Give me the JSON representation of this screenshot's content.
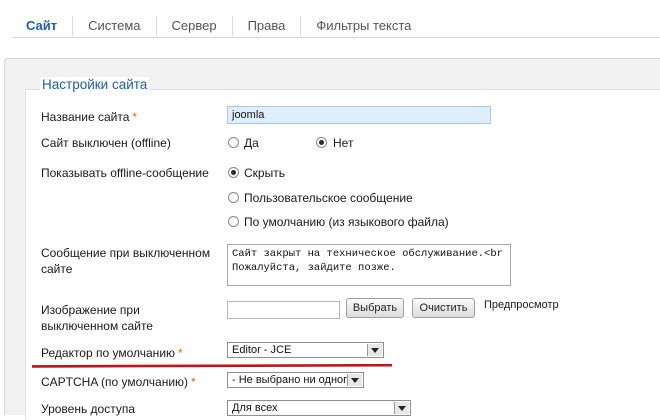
{
  "tabs": [
    {
      "label": "Сайт"
    },
    {
      "label": "Система"
    },
    {
      "label": "Сервер"
    },
    {
      "label": "Права"
    },
    {
      "label": "Фильтры текста"
    }
  ],
  "section": {
    "legend": "Настройки сайта"
  },
  "fields": {
    "site_name": {
      "label": "Название сайта",
      "required": "*",
      "value": "joomla"
    },
    "offline": {
      "label": "Сайт выключен (offline)",
      "option_yes": "Да",
      "option_no": "Нет"
    },
    "offline_message_show": {
      "label": "Показывать offline-сообщение",
      "option_hide": "Скрыть",
      "option_custom": "Пользовательское сообщение",
      "option_default": "По умолчанию (из языкового файла)"
    },
    "offline_message": {
      "label_line1": "Сообщение при выключенном",
      "label_line2": "сайте",
      "value": "Сайт закрыт на техническое обслуживание.<br />\nПожалуйста, зайдите позже."
    },
    "offline_image": {
      "label_line1": "Изображение при",
      "label_line2": "выключенном сайте",
      "select_label": "Выбрать",
      "clear_label": "Очистить",
      "preview_label": "Предпросмотр"
    },
    "default_editor": {
      "label": "Редактор по умолчанию",
      "required": "*",
      "value": "Editor - JCE"
    },
    "captcha": {
      "label": "CAPTCHA (по умолчанию)",
      "required": "*",
      "value": "- Не выбрано ни одного -"
    },
    "access": {
      "label": "Уровень доступа",
      "value": "Для всех"
    }
  },
  "colors": {
    "accent": "#1e5fa6",
    "required": "#e06a00",
    "annotation": "#c0141b"
  }
}
